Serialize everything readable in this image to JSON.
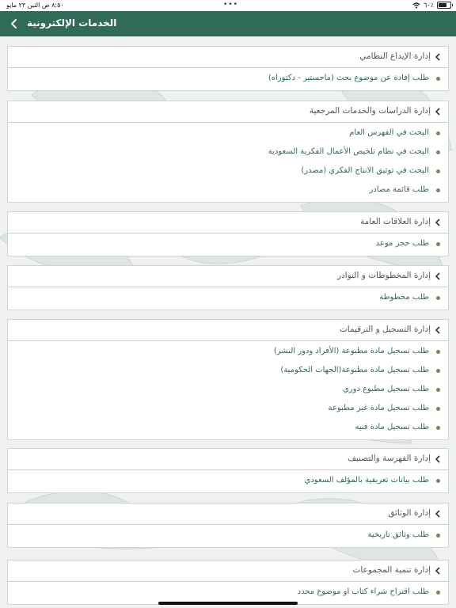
{
  "status_bar": {
    "time": "٨:٥٠ ص",
    "date": "الثين ٢٣ مايو",
    "battery": "٦٠٪",
    "battery_level": 0.6
  },
  "nav": {
    "title": "الخدمات الإلكترونية",
    "back_icon": "chevron-left-icon"
  },
  "sections": [
    {
      "title": "إدارة الإيداع النظامي",
      "items": [
        "طلب إفادة عن موضوع بحث (ماجستير - دكتوراه)"
      ]
    },
    {
      "title": "إدارة الدراسات والخدمات المرجعية",
      "items": [
        "البحث في الفهرس العام",
        "البحث في نظام تلخيص الأعمال الفكرية السعودية",
        "البحث في توثيق الانتاج الفكري (مصدر)",
        "طلب قائمة مصادر"
      ]
    },
    {
      "title": "إدارة العلاقات العامة",
      "items": [
        "طلب حجز موعد"
      ]
    },
    {
      "title": "إدارة المخطوطات و النوادر",
      "items": [
        "طلب مخطوطة"
      ]
    },
    {
      "title": "إدارة التسجيل و الترقيمات",
      "items": [
        "طلب تسجيل مادة مطبوعة (الأفراد ودور النشر)",
        "طلب تسجيل مادة مطبوعة(الجهات الحكومية)",
        "طلب تسجيل مطبوع دوري",
        "طلب تسجيل مادة غير مطبوعة",
        "طلب تسجيل مادة فنيه"
      ]
    },
    {
      "title": "إدارة الفهرسة والتصنيف",
      "items": [
        "طلب بيانات تعريفية بالمؤلف السعودي"
      ]
    },
    {
      "title": "إدارة الوثائق",
      "items": [
        "طلب وثائق تاريخية"
      ]
    },
    {
      "title": "إدارة تنمية المجموعات",
      "items": [
        "طلب اقتراح شراء كتاب او موضوع محدد"
      ]
    }
  ],
  "colors": {
    "nav_bg": "#2f6b57",
    "item_text": "#2f6b57",
    "bullet": "#8a7d58"
  }
}
